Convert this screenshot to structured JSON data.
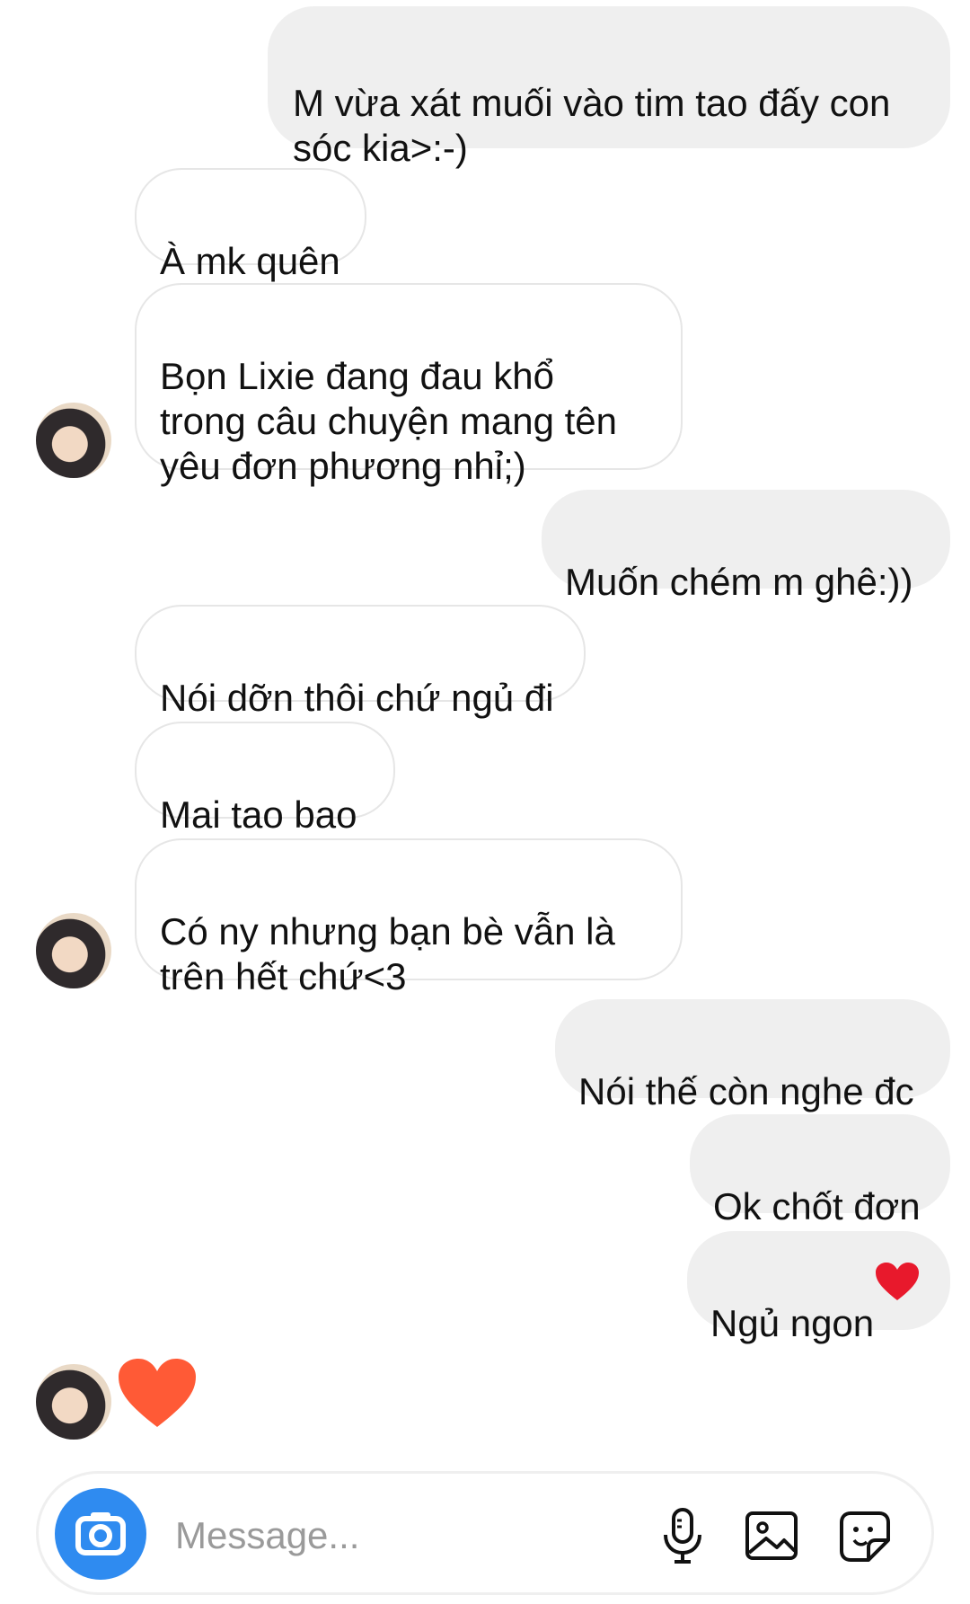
{
  "messages": [
    {
      "from": "me",
      "text": "M vừa xát muối vào tim tao đấy con\nsóc kia>:-)"
    },
    {
      "from": "them",
      "text": "À mk quên"
    },
    {
      "from": "them",
      "text": "Bọn Lixie đang đau khổ\ntrong câu chuyện mang tên\nyêu đơn phương nhỉ;)"
    },
    {
      "from": "me",
      "text": "Muốn chém m ghê:))"
    },
    {
      "from": "them",
      "text": "Nói dỡn thôi chứ ngủ đi"
    },
    {
      "from": "them",
      "text": "Mai tao bao"
    },
    {
      "from": "them",
      "text": "Có ny nhưng bạn bè vẫn là\ntrên hết chứ<3"
    },
    {
      "from": "me",
      "text": "Nói thế còn nghe đc"
    },
    {
      "from": "me",
      "text": "Ok chốt đơn"
    },
    {
      "from": "me",
      "text": "Ngủ ngon"
    }
  ],
  "reaction": {
    "icon": "heart-icon",
    "color": "#ff5a36"
  },
  "composer": {
    "placeholder": "Message..."
  },
  "colors": {
    "accent": "#2f8bf0",
    "outgoing_bubble": "#efefef",
    "incoming_border": "#e6e6e6",
    "heart_emoji": "#e8192c"
  }
}
